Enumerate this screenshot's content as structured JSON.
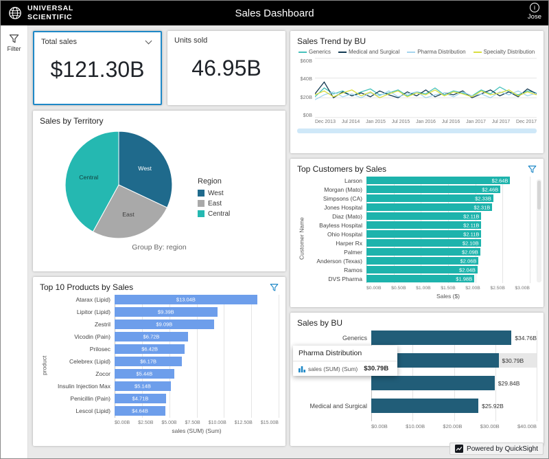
{
  "header": {
    "brand_line1": "UNIVERSAL",
    "brand_line2": "SCIENTIFIC",
    "title": "Sales Dashboard",
    "user": "Jose"
  },
  "sidebar": {
    "filter_label": "Filter"
  },
  "kpis": {
    "total_sales": {
      "label": "Total sales",
      "value": "$121.30B"
    },
    "units_sold": {
      "label": "Units sold",
      "value": "46.95B"
    }
  },
  "footer": {
    "powered_by": "Powered by QuickSight"
  },
  "colors": {
    "accent_blue": "#1e88c7",
    "header_bg": "#000000",
    "page_bg": "#e9e9e9"
  },
  "chart_data": [
    {
      "id": "sales_trend_by_bu",
      "type": "line",
      "title": "Sales Trend by BU",
      "x_ticks": [
        "Dec 2013",
        "Jul 2014",
        "Jan 2015",
        "Jul 2015",
        "Jan 2016",
        "Jul 2016",
        "Jan 2017",
        "Jul 2017",
        "Dec 2017"
      ],
      "y_ticks": [
        "$60B",
        "$40B",
        "$20B",
        "$0B"
      ],
      "ylim": [
        0,
        60
      ],
      "legend_position": "top",
      "series": [
        {
          "name": "Generics",
          "color": "#45c1bb",
          "values": [
            21,
            30,
            24,
            27,
            22,
            26,
            29,
            23,
            25,
            28,
            22,
            26,
            24,
            30,
            23,
            27,
            25,
            22,
            28,
            24,
            31,
            26,
            23,
            27,
            25
          ]
        },
        {
          "name": "Medical and Surgical",
          "color": "#123a52",
          "values": [
            24,
            36,
            20,
            26,
            22,
            25,
            21,
            27,
            23,
            20,
            26,
            22,
            28,
            21,
            25,
            23,
            27,
            20,
            24,
            28,
            22,
            26,
            21,
            29,
            24
          ]
        },
        {
          "name": "Pharma Distribution",
          "color": "#a5d5ee",
          "values": [
            18,
            23,
            26,
            21,
            24,
            20,
            25,
            22,
            27,
            21,
            24,
            26,
            20,
            23,
            25,
            21,
            26,
            22,
            24,
            20,
            26,
            23,
            27,
            22,
            25
          ]
        },
        {
          "name": "Specialty Distribution",
          "color": "#d9de3f",
          "values": [
            23,
            27,
            21,
            25,
            28,
            22,
            26,
            20,
            24,
            27,
            21,
            25,
            23,
            28,
            22,
            26,
            24,
            21,
            27,
            23,
            25,
            28,
            22,
            26,
            23
          ]
        }
      ]
    },
    {
      "id": "sales_by_territory",
      "type": "pie",
      "title": "Sales by Territory",
      "legend_title": "Region",
      "footer": "Group By: region",
      "slices": [
        {
          "name": "West",
          "value": 32,
          "color": "#1f6a8c",
          "label_color": "#ffffff"
        },
        {
          "name": "East",
          "value": 26,
          "color": "#a9a9a9",
          "label_color": "#3d3d3d"
        },
        {
          "name": "Central",
          "value": 42,
          "color": "#25b8b1",
          "label_color": "#123f3c"
        }
      ]
    },
    {
      "id": "top_10_products_by_sales",
      "type": "bar",
      "orientation": "horizontal",
      "title": "Top 10 Products by Sales",
      "categories": [
        "Atarax (Lipid)",
        "Lipitor (Lipid)",
        "Zestril",
        "Vicodin (Pain)",
        "Prilosec",
        "Celebrex (Lipid)",
        "Zocor",
        "Insulin Injection Max",
        "Penicillin (Pain)",
        "Lescol (Lipid)"
      ],
      "values": [
        13.04,
        9.39,
        9.09,
        6.72,
        6.42,
        6.17,
        5.44,
        5.14,
        4.71,
        4.64
      ],
      "value_labels": [
        "$13.04B",
        "$9.39B",
        "$9.09B",
        "$6.72B",
        "$6.42B",
        "$6.17B",
        "$5.44B",
        "$5.14B",
        "$4.71B",
        "$4.64B"
      ],
      "x_ticks": [
        "$0.00B",
        "$2.50B",
        "$5.00B",
        "$7.50B",
        "$10.00B",
        "$12.50B",
        "$15.00B"
      ],
      "xlim": [
        0,
        15
      ],
      "xlabel": "sales (SUM) (Sum)",
      "ylabel": "product",
      "bar_color": "#6d9eeb",
      "value_position": "center"
    },
    {
      "id": "top_customers_by_sales",
      "type": "bar",
      "orientation": "horizontal",
      "title": "Top Customers by Sales",
      "categories": [
        "Larson",
        "Morgan (Mato)",
        "Simpsons (CA)",
        "Jones Hospital",
        "Diaz (Mato)",
        "Bayless Hospital",
        "Ohio Hospital",
        "Harper Rx",
        "Palmer",
        "Anderson (Texas)",
        "Ramos",
        "DVS Pharma"
      ],
      "values": [
        2.64,
        2.46,
        2.33,
        2.31,
        2.11,
        2.11,
        2.11,
        2.1,
        2.09,
        2.06,
        2.04,
        1.98
      ],
      "value_labels": [
        "$2.64B",
        "$2.46B",
        "$2.33B",
        "$2.31B",
        "$2.11B",
        "$2.11B",
        "$2.11B",
        "$2.10B",
        "$2.09B",
        "$2.06B",
        "$2.04B",
        "$1.98B"
      ],
      "x_ticks": [
        "$0.00B",
        "$0.50B",
        "$1.00B",
        "$1.50B",
        "$2.00B",
        "$2.50B",
        "$3.00B"
      ],
      "xlim": [
        0,
        3
      ],
      "xlabel": "Sales ($)",
      "ylabel": "Customer Name",
      "bar_color": "#1db3ac",
      "value_position": "end"
    },
    {
      "id": "sales_by_bu",
      "type": "bar",
      "orientation": "horizontal",
      "title": "Sales by BU",
      "categories": [
        "Generics",
        "Pharma Distribution",
        "",
        "Medical and Surgical"
      ],
      "values": [
        34.76,
        30.79,
        29.84,
        25.92
      ],
      "value_labels": [
        "$34.76B",
        "$30.79B",
        "$29.84B",
        "$25.92B"
      ],
      "x_ticks": [
        "$0.00B",
        "$10.00B",
        "$20.00B",
        "$30.00B",
        "$40.00B"
      ],
      "xlim": [
        0,
        40
      ],
      "xlabel": "",
      "ylabel": "",
      "bar_color": "#215d78",
      "value_position": "outside",
      "highlight_index": 1,
      "tooltip": {
        "title": "Pharma Distribution",
        "series_label": "sales (SUM) (Sum)",
        "value": "$30.79B"
      }
    }
  ]
}
